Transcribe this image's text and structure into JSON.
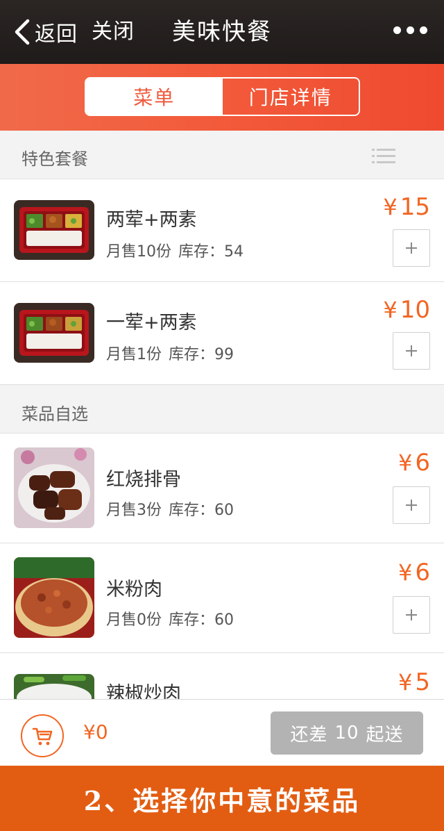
{
  "nav": {
    "back_label": "返回",
    "close_label": "关闭",
    "title": "美味快餐"
  },
  "tabs": [
    {
      "label": "菜单",
      "active": true
    },
    {
      "label": "门店详情",
      "active": false
    }
  ],
  "sections": [
    {
      "title": "特色套餐",
      "items": [
        {
          "name": "两荤+两素",
          "sold": "月售10份",
          "stock_label": "库存：",
          "stock": "54",
          "currency": "¥",
          "price": "15",
          "image": "bento-meal"
        },
        {
          "name": "一荤+两素",
          "sold": "月售1份",
          "stock_label": "库存：",
          "stock": "99",
          "currency": "¥",
          "price": "10",
          "image": "bento-meal"
        }
      ]
    },
    {
      "title": "菜品自选",
      "items": [
        {
          "name": "红烧排骨",
          "sold": "月售3份",
          "stock_label": "库存：",
          "stock": "60",
          "currency": "¥",
          "price": "6",
          "image": "braised-ribs"
        },
        {
          "name": "米粉肉",
          "sold": "月售0份",
          "stock_label": "库存：",
          "stock": "60",
          "currency": "¥",
          "price": "6",
          "image": "steamed-pork"
        },
        {
          "name": "辣椒炒肉",
          "currency": "¥",
          "price": "5",
          "image": "pepper-pork"
        }
      ]
    }
  ],
  "cart": {
    "currency": "¥",
    "total": "0",
    "checkout_prefix": "还差",
    "checkout_amount": "10",
    "checkout_suffix": "起送"
  },
  "caption": "2、选择你中意的菜品",
  "colors": {
    "accent": "#f26522",
    "header": "#ef5a3c",
    "caption_bg": "#e25d12",
    "disabled_button": "#b3b3b3"
  },
  "icons": [
    "chevron-left-icon",
    "more-icon",
    "list-icon",
    "plus-icon",
    "cart-icon"
  ]
}
